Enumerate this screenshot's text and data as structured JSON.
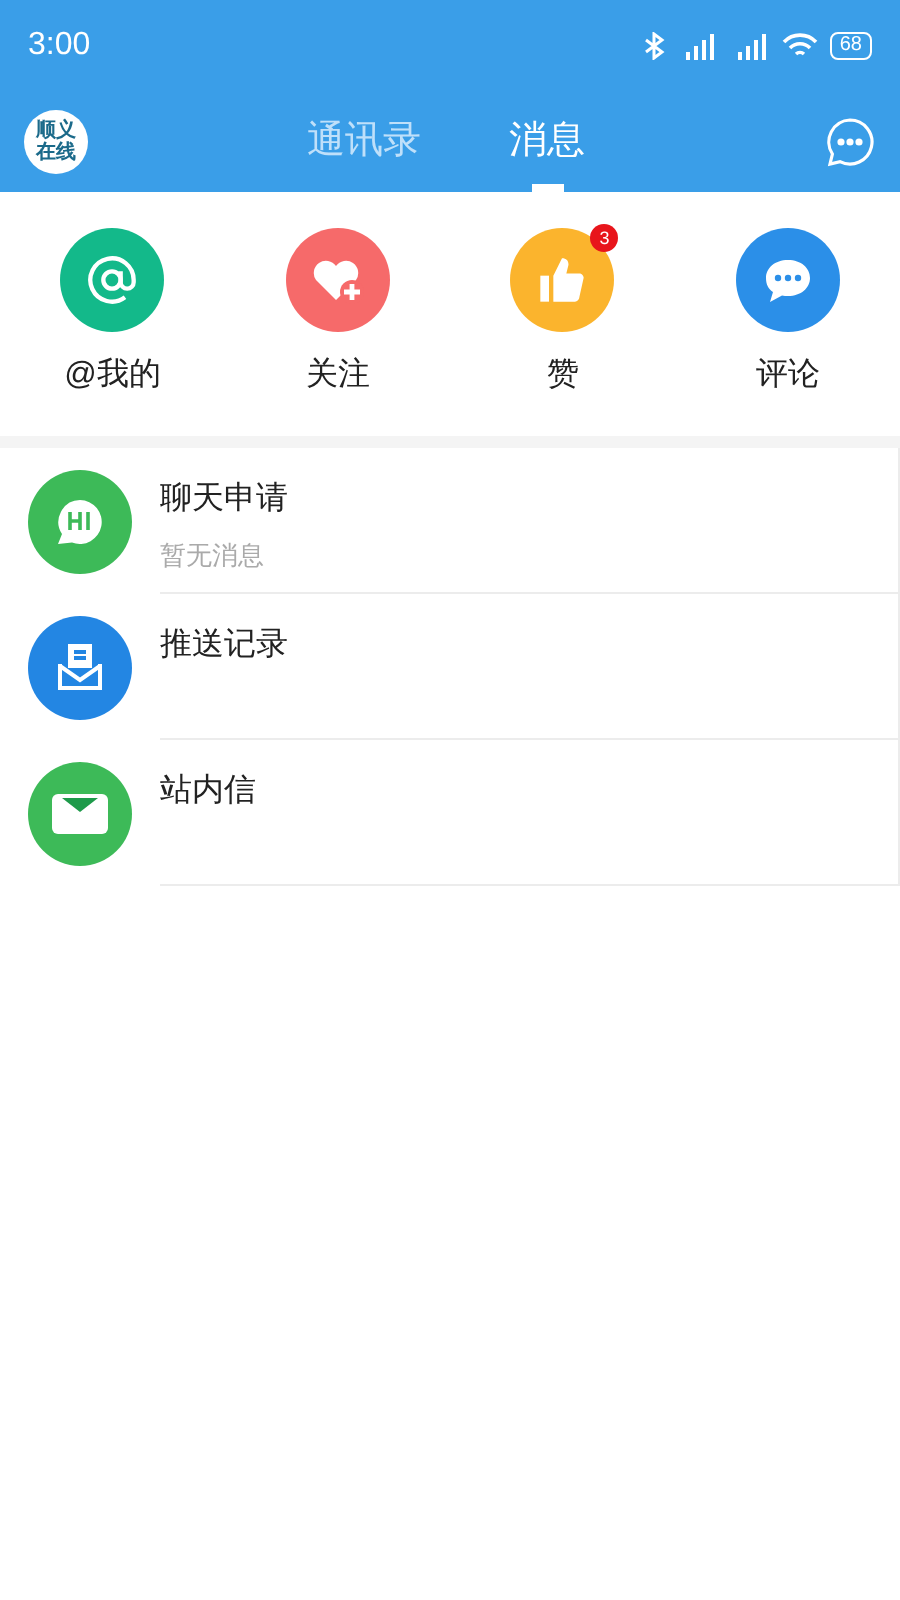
{
  "status_bar": {
    "time": "3:00",
    "battery": "68"
  },
  "header": {
    "logo": "顺义在线",
    "tabs": [
      {
        "label": "通讯录",
        "selected": false
      },
      {
        "label": "消息",
        "selected": true
      }
    ]
  },
  "shortcuts": [
    {
      "kind": "at",
      "label": "@我的",
      "color": "#13b98a"
    },
    {
      "kind": "follow",
      "label": "关注",
      "color": "#f66a6a"
    },
    {
      "kind": "like",
      "label": "赞",
      "color": "#fbb42d",
      "badge": "3"
    },
    {
      "kind": "comment",
      "label": "评论",
      "color": "#2b8fe8"
    }
  ],
  "messages": [
    {
      "kind": "hi",
      "title": "聊天申请",
      "subtitle": "暂无消息",
      "color": "#3dba58"
    },
    {
      "kind": "push",
      "title": "推送记录",
      "color": "#2386e3"
    },
    {
      "kind": "mail",
      "title": "站内信",
      "color": "#3dba58"
    }
  ]
}
